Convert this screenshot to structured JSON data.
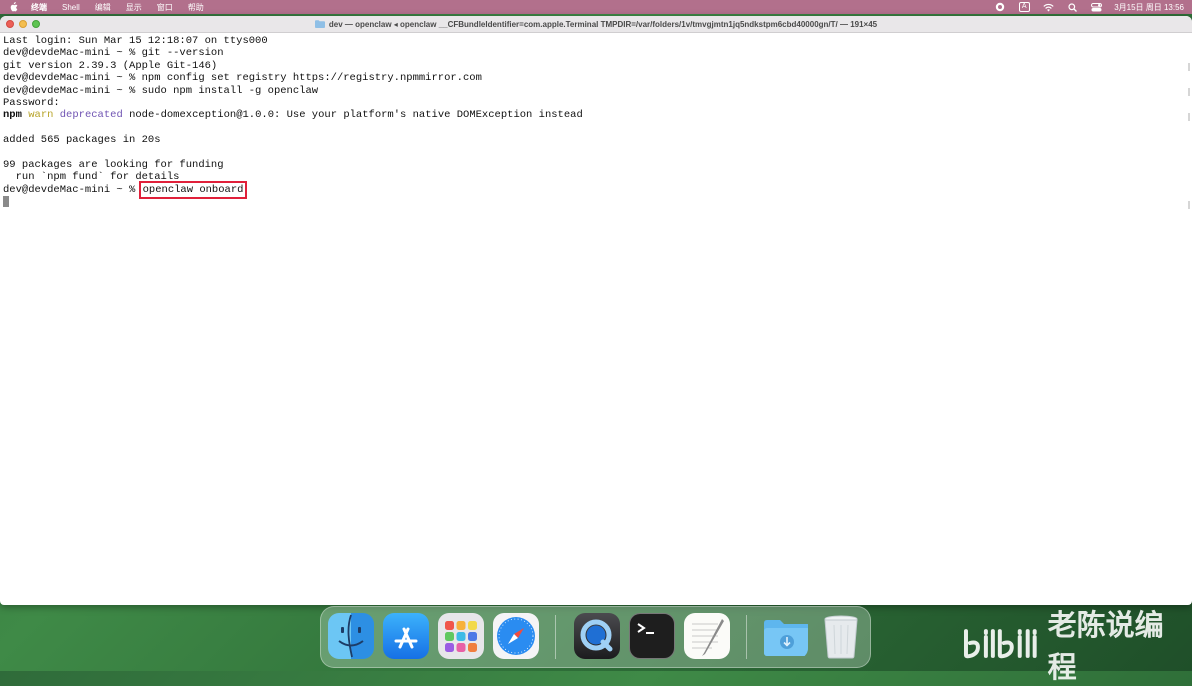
{
  "menubar": {
    "app_name": "终端",
    "items": [
      "Shell",
      "编辑",
      "显示",
      "窗口",
      "帮助"
    ],
    "input_indicator": "A",
    "clock": "3月15日 周日 13:56"
  },
  "window": {
    "title": "dev — openclaw ◂ openclaw __CFBundleIdentifier=com.apple.Terminal TMPDIR=/var/folders/1v/tmvgjmtn1jq5ndkstpm6cbd40000gn/T/ — 191×45"
  },
  "terminal": {
    "lines": [
      "Last login: Sun Mar 15 12:18:07 on ttys000",
      "dev@devdeMac-mini ~ % git --version",
      "git version 2.39.3 (Apple Git-146)",
      "dev@devdeMac-mini ~ % npm config set registry https://registry.npmmirror.com",
      "dev@devdeMac-mini ~ % sudo npm install -g openclaw",
      "Password:"
    ],
    "warn_line": {
      "npm": "npm",
      "warn": "warn",
      "deprecated": "deprecated",
      "message": "node-domexception@1.0.0: Use your platform's native DOMException instead"
    },
    "lines2": [
      "",
      "added 565 packages in 20s",
      "",
      "99 packages are looking for funding",
      "  run `npm fund` for details"
    ],
    "prompt": "dev@devdeMac-mini ~ % ",
    "current_command": "openclaw onboard"
  },
  "dock": {
    "apps": [
      "finder-icon",
      "app-store-icon",
      "launchpad-icon",
      "safari-icon",
      "quicktime-icon",
      "terminal-icon",
      "textedit-icon",
      "downloads-folder-icon",
      "trash-icon"
    ]
  },
  "watermark": {
    "text": "老陈说编程",
    "logo": "bilibili"
  },
  "colors": {
    "menubar": "#b2708c",
    "highlight_box": "#e0203a",
    "warn": "#b8a42a",
    "deprecated": "#7054b3"
  }
}
